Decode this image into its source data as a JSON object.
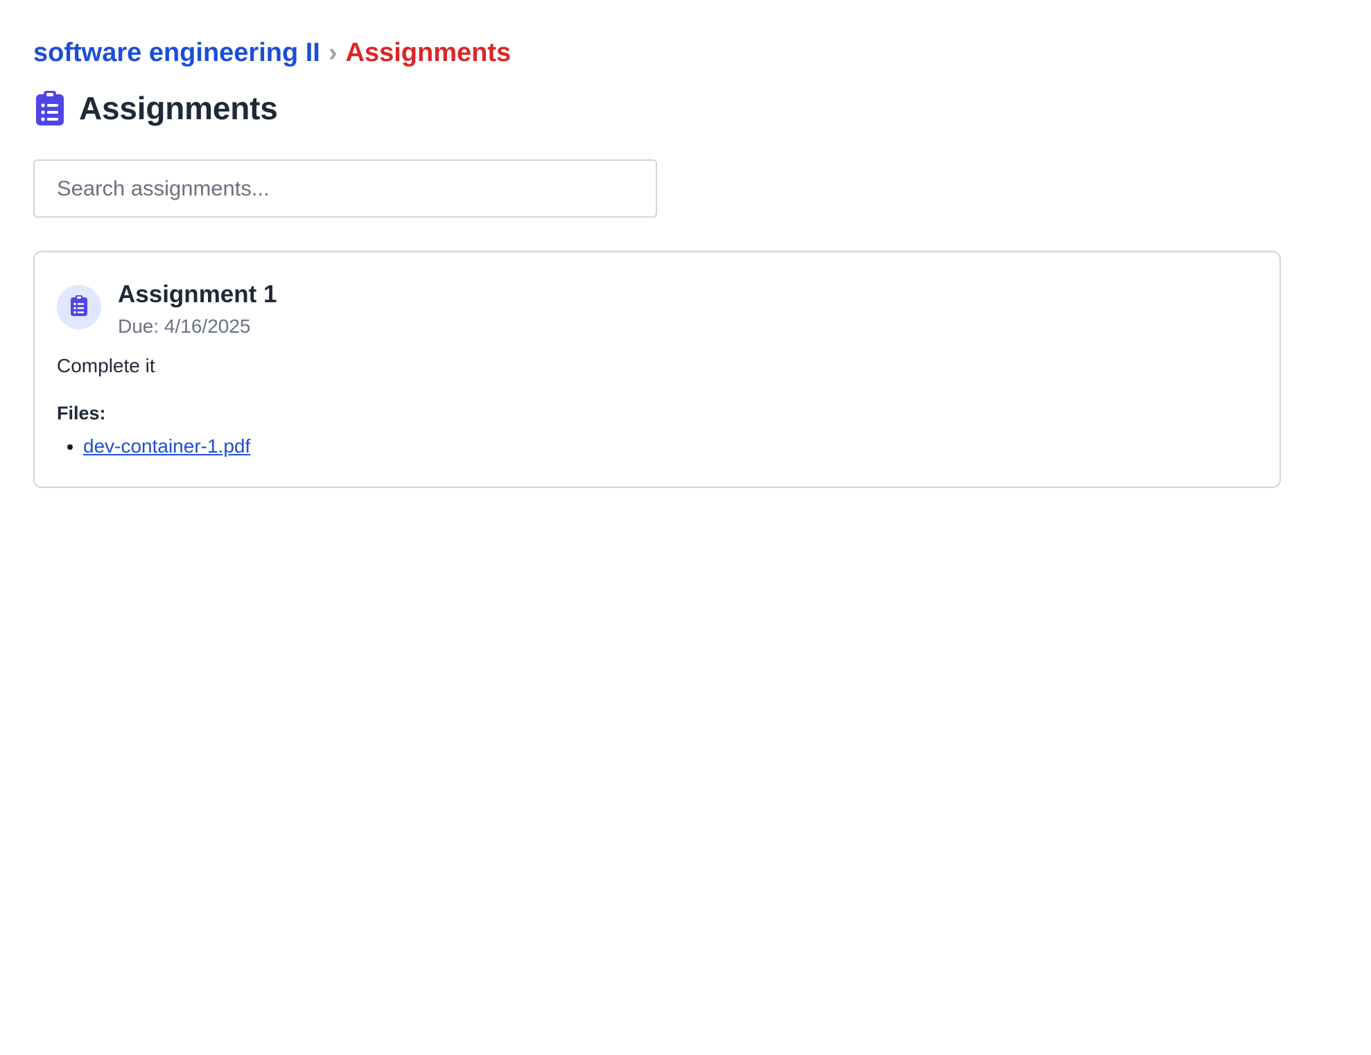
{
  "breadcrumb": {
    "course": "software engineering II",
    "separator": "›",
    "current": "Assignments"
  },
  "header": {
    "icon": "clipboard-list-icon",
    "title": "Assignments"
  },
  "search": {
    "placeholder": "Search assignments...",
    "value": ""
  },
  "assignments": [
    {
      "icon": "clipboard-list-icon",
      "title": "Assignment 1",
      "due": "Due: 4/16/2025",
      "description": "Complete it",
      "files_label": "Files:",
      "files": [
        "dev-container-1.pdf"
      ]
    }
  ],
  "colors": {
    "accent": "#4f46e5",
    "link": "#1d4ed8",
    "breadcrumb_current": "#dc2626",
    "icon_circle_bg": "#e0e7ff"
  }
}
